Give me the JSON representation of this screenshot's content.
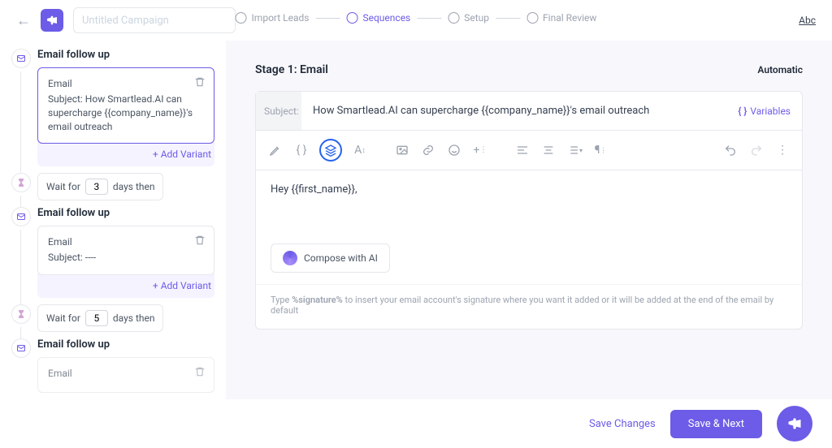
{
  "header": {
    "campaign_placeholder": "Untitled Campaign",
    "abc": "Abc"
  },
  "steps": {
    "s1": "Import Leads",
    "s2": "Sequences",
    "s3": "Setup",
    "s4": "Final Review"
  },
  "sidebar": {
    "followup_label": "Email follow up",
    "email_label": "Email",
    "subject1": "Subject: How Smartlead.AI can supercharge {{company_name}}'s email outreach",
    "subject2": "Subject: ----",
    "add_variant": "+ Add Variant",
    "wait_prefix": "Wait for",
    "wait_suffix": "days then",
    "wait1": "3",
    "wait2": "5"
  },
  "main": {
    "stage_title": "Stage 1: Email",
    "automatic": "Automatic",
    "subject_label": "Subject:",
    "subject_value": "How Smartlead.AI can supercharge {{company_name}}'s email outreach",
    "variables": "Variables",
    "body": "Hey  {{first_name}},",
    "compose_ai": "Compose with AI",
    "hint_pre": "Type ",
    "hint_bold": "%signature%",
    "hint_post": " to insert your email account's signature where you want it added or it will be added at the end of the email by default"
  },
  "footer": {
    "save_changes": "Save Changes",
    "save_next": "Save & Next"
  }
}
